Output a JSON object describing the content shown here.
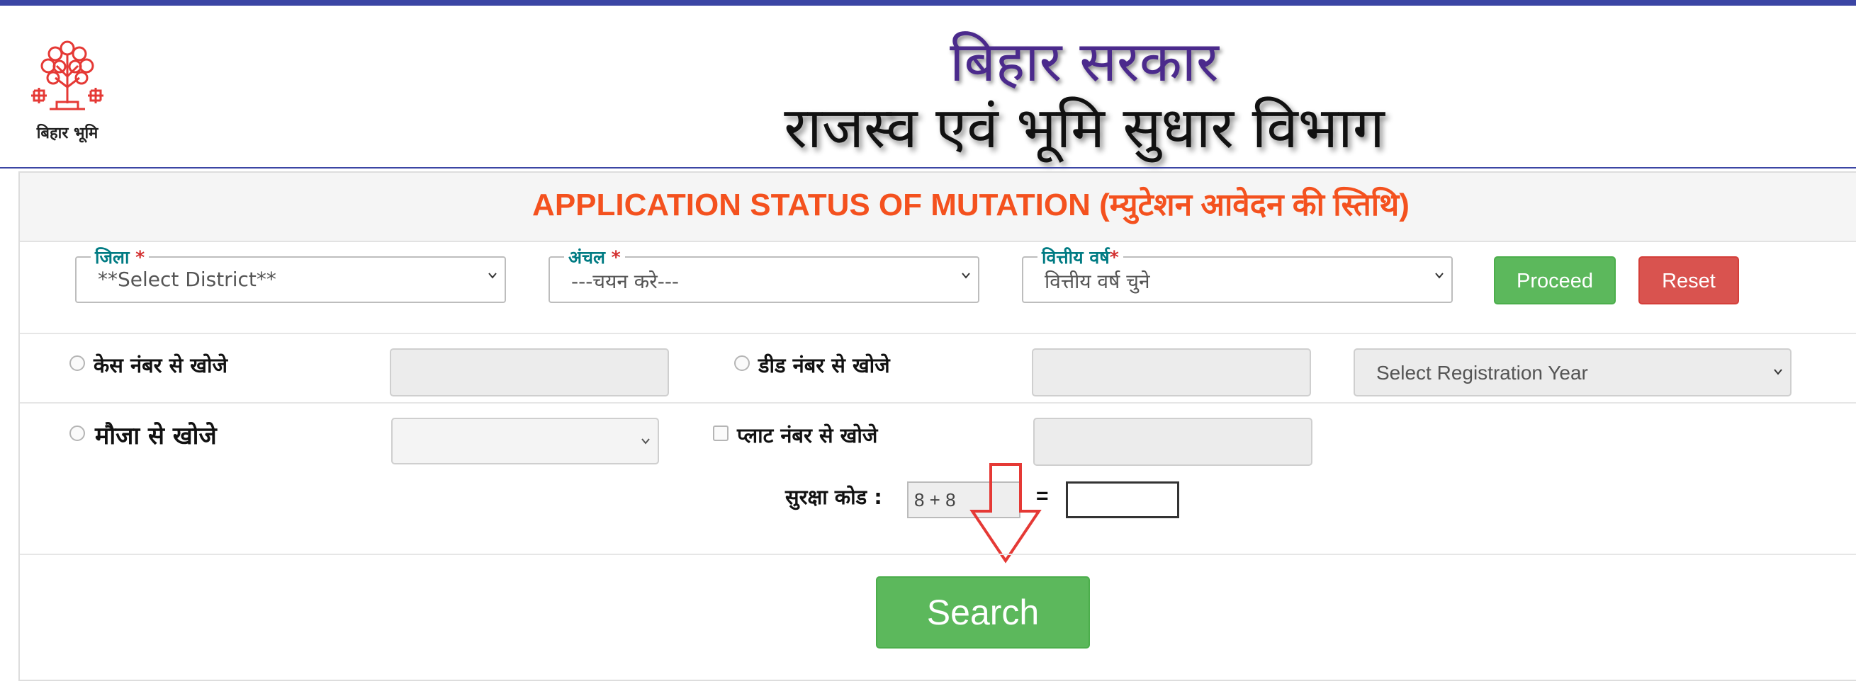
{
  "header": {
    "logo_text": "बिहार भूमि",
    "gov_title": "बिहार सरकार",
    "dept_title": "राजस्व एवं भूमि सुधार विभाग"
  },
  "panel": {
    "title": "APPLICATION STATUS OF MUTATION (म्युटेशन आवेदन की स्तिथि)"
  },
  "filters": {
    "district": {
      "label": "जिला",
      "required_mark": "*",
      "value": "**Select District**"
    },
    "circle": {
      "label": "अंचल",
      "required_mark": "*",
      "value": "---चयन करे---"
    },
    "fin_year": {
      "label": "वित्तीय वर्ष",
      "required_mark": "*",
      "value": "वित्तीय वर्ष चुने"
    },
    "proceed_label": "Proceed",
    "reset_label": "Reset"
  },
  "search_options": {
    "case_label": "केस नंबर से खोजे",
    "deed_label": "डीड नंबर से खोजे",
    "reg_year_placeholder": "Select Registration Year",
    "mauja_label": "मौजा से खोजे",
    "plot_label": "प्लाट नंबर से खोजे"
  },
  "captcha": {
    "label": "सुरक्षा कोड :",
    "expression": "8 + 8",
    "equals": "="
  },
  "search_label": "Search",
  "colors": {
    "topbar": "#3b45a4",
    "title_orange": "#f4511e",
    "legend_teal": "#007b83",
    "button_green": "#5cb85c",
    "button_red": "#d9534f",
    "arrow_red": "#e53935"
  }
}
